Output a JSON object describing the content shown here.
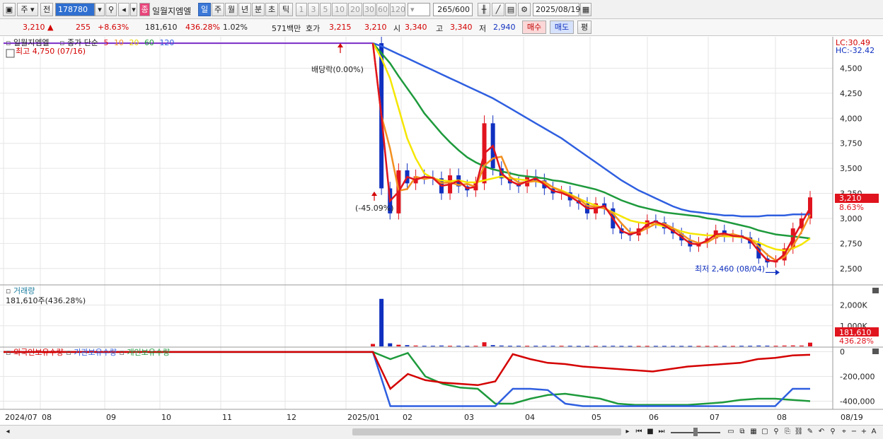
{
  "toolbar": {
    "market": "주",
    "prev": "전",
    "code": "178780",
    "stock_name": "일월지엠엘",
    "stock_tag": "종",
    "periods": [
      "일",
      "주",
      "월",
      "년",
      "분",
      "초",
      "틱"
    ],
    "minutes": [
      "1",
      "3",
      "5",
      "10",
      "20",
      "30",
      "60",
      "120"
    ],
    "count": "265",
    "count_total": "/600",
    "date": "2025/08/19"
  },
  "quote": {
    "price": "3,210",
    "change": "255",
    "change_pct": "+8.63%",
    "volume": "181,610",
    "volume_pct": "436.28%",
    "turnover": "1.02%",
    "amount": "571백만",
    "bid_label": "호가",
    "bid": "3,215",
    "ask": "3,210",
    "open_label": "시",
    "open": "3,340",
    "high_label": "고",
    "high": "3,340",
    "low_label": "저",
    "low": "2,940",
    "buy": "매수",
    "sell": "매도",
    "eval": "평"
  },
  "price_panel": {
    "name": "일월지엠엘",
    "ma_label": "종가 단순",
    "ma_periods": [
      "5",
      "10",
      "20",
      "60",
      "120"
    ],
    "high_note": "최고 4,750 (07/16)",
    "dividend_note": "배당락(0.00%)",
    "drop_note": "(-45.09%)",
    "low_note": "최저 2,460 (08/04)",
    "lc": "LC:30.49",
    "hc": "HC:-32.42",
    "current_price": "3,210",
    "current_pct": "8.63%",
    "ticks": [
      "4,500",
      "4,250",
      "4,000",
      "3,750",
      "3,500",
      "3,250",
      "3,000",
      "2,750",
      "2,500"
    ]
  },
  "volume_panel": {
    "title": "거래량",
    "value": "181,610주(436.28%)",
    "ticks": [
      "2,000K",
      "1,000K"
    ],
    "current": "181,610",
    "current_pct": "436.28%"
  },
  "holdings_panel": {
    "legend": [
      "외국인보유수량",
      "기관보유수량",
      "개인보유수량"
    ],
    "ticks": [
      "0",
      "-200,000",
      "-400,000"
    ]
  },
  "x_axis": [
    "2024/07",
    "08",
    "09",
    "10",
    "11",
    "12",
    "2025/01",
    "02",
    "03",
    "04",
    "05",
    "06",
    "07",
    "08",
    "08/19"
  ],
  "colors": {
    "ma5": "#e0141e",
    "ma10": "#f39020",
    "ma20": "#f5e600",
    "ma60": "#1e9a3c",
    "ma120": "#2f5fe0",
    "up": "#e0141e",
    "down": "#1030c0"
  },
  "chart_data": {
    "type": "line",
    "price_ylim": [
      2350,
      4800
    ],
    "price": {
      "pre_flat": 4750,
      "close": [
        4750,
        3300,
        3050,
        3480,
        3350,
        3420,
        3410,
        3400,
        3250,
        3430,
        3320,
        3280,
        3350,
        3950,
        3500,
        3400,
        3350,
        3320,
        3420,
        3380,
        3300,
        3250,
        3260,
        3180,
        3150,
        3050,
        3150,
        3100,
        2900,
        2850,
        2830,
        2900,
        2980,
        2960,
        2900,
        2850,
        2780,
        2720,
        2760,
        2800,
        2880,
        2820,
        2830,
        2810,
        2750,
        2600,
        2560,
        2580,
        2700,
        2900,
        3000,
        3210
      ]
    },
    "ma20": [
      4750,
      4600,
      4400,
      4100,
      3800,
      3600,
      3450,
      3400,
      3380,
      3370,
      3380,
      3360,
      3360,
      3380,
      3400,
      3420,
      3400,
      3390,
      3380,
      3370,
      3350,
      3310,
      3280,
      3240,
      3200,
      3160,
      3130,
      3100,
      3060,
      3020,
      2980,
      2960,
      2950,
      2940,
      2920,
      2900,
      2870,
      2850,
      2840,
      2830,
      2830,
      2820,
      2820,
      2810,
      2790,
      2760,
      2720,
      2690,
      2680,
      2700,
      2740,
      2800
    ],
    "ma60": [
      4750,
      4650,
      4550,
      4420,
      4300,
      4180,
      4050,
      3950,
      3850,
      3760,
      3680,
      3610,
      3560,
      3520,
      3490,
      3470,
      3450,
      3430,
      3420,
      3410,
      3400,
      3380,
      3370,
      3350,
      3330,
      3310,
      3290,
      3260,
      3220,
      3180,
      3150,
      3120,
      3100,
      3080,
      3060,
      3050,
      3040,
      3030,
      3020,
      3000,
      2990,
      2970,
      2950,
      2930,
      2910,
      2880,
      2860,
      2840,
      2830,
      2820,
      2810,
      2800
    ],
    "ma120": [
      4750,
      4720,
      4680,
      4640,
      4600,
      4560,
      4520,
      4480,
      4440,
      4400,
      4360,
      4320,
      4280,
      4240,
      4200,
      4150,
      4100,
      4050,
      4000,
      3950,
      3900,
      3850,
      3800,
      3740,
      3680,
      3620,
      3560,
      3500,
      3440,
      3380,
      3330,
      3280,
      3240,
      3200,
      3160,
      3120,
      3090,
      3070,
      3060,
      3050,
      3040,
      3030,
      3030,
      3020,
      3020,
      3020,
      3030,
      3030,
      3030,
      3040,
      3040,
      3040
    ],
    "volume": [
      120,
      2300,
      150,
      80,
      60,
      40,
      30,
      30,
      40,
      30,
      30,
      25,
      30,
      200,
      60,
      40,
      30,
      30,
      30,
      30,
      30,
      30,
      30,
      30,
      25,
      25,
      25,
      25,
      30,
      25,
      25,
      25,
      25,
      25,
      25,
      25,
      25,
      25,
      25,
      25,
      25,
      25,
      25,
      30,
      30,
      40,
      35,
      30,
      40,
      45,
      40,
      181.61
    ],
    "volume_ylim": [
      0,
      2600
    ],
    "foreign": [
      -2000,
      -300000,
      -180000,
      -230000,
      -250000,
      -260000,
      -270000,
      -240000,
      -20000,
      -60000,
      -90000,
      -100000,
      -120000,
      -130000,
      -140000,
      -150000,
      -160000,
      -140000,
      -120000,
      -110000,
      -100000,
      -90000,
      -60000,
      -50000,
      -30000,
      -25000
    ],
    "institution": [
      -2000,
      -440000,
      -440000,
      -440000,
      -440000,
      -440000,
      -440000,
      -440000,
      -300000,
      -300000,
      -310000,
      -420000,
      -440000,
      -440000,
      -440000,
      -440000,
      -440000,
      -440000,
      -440000,
      -440000,
      -440000,
      -440000,
      -440000,
      -440000,
      -300000,
      -300000
    ],
    "individual": [
      -2000,
      -60000,
      -10000,
      -200000,
      -260000,
      -290000,
      -300000,
      -420000,
      -420000,
      -380000,
      -350000,
      -340000,
      -360000,
      -380000,
      -420000,
      -430000,
      -430000,
      -430000,
      -430000,
      -420000,
      -410000,
      -390000,
      -380000,
      -380000,
      -390000,
      -400000
    ],
    "holdings_ylim": [
      -460000,
      20000
    ]
  }
}
